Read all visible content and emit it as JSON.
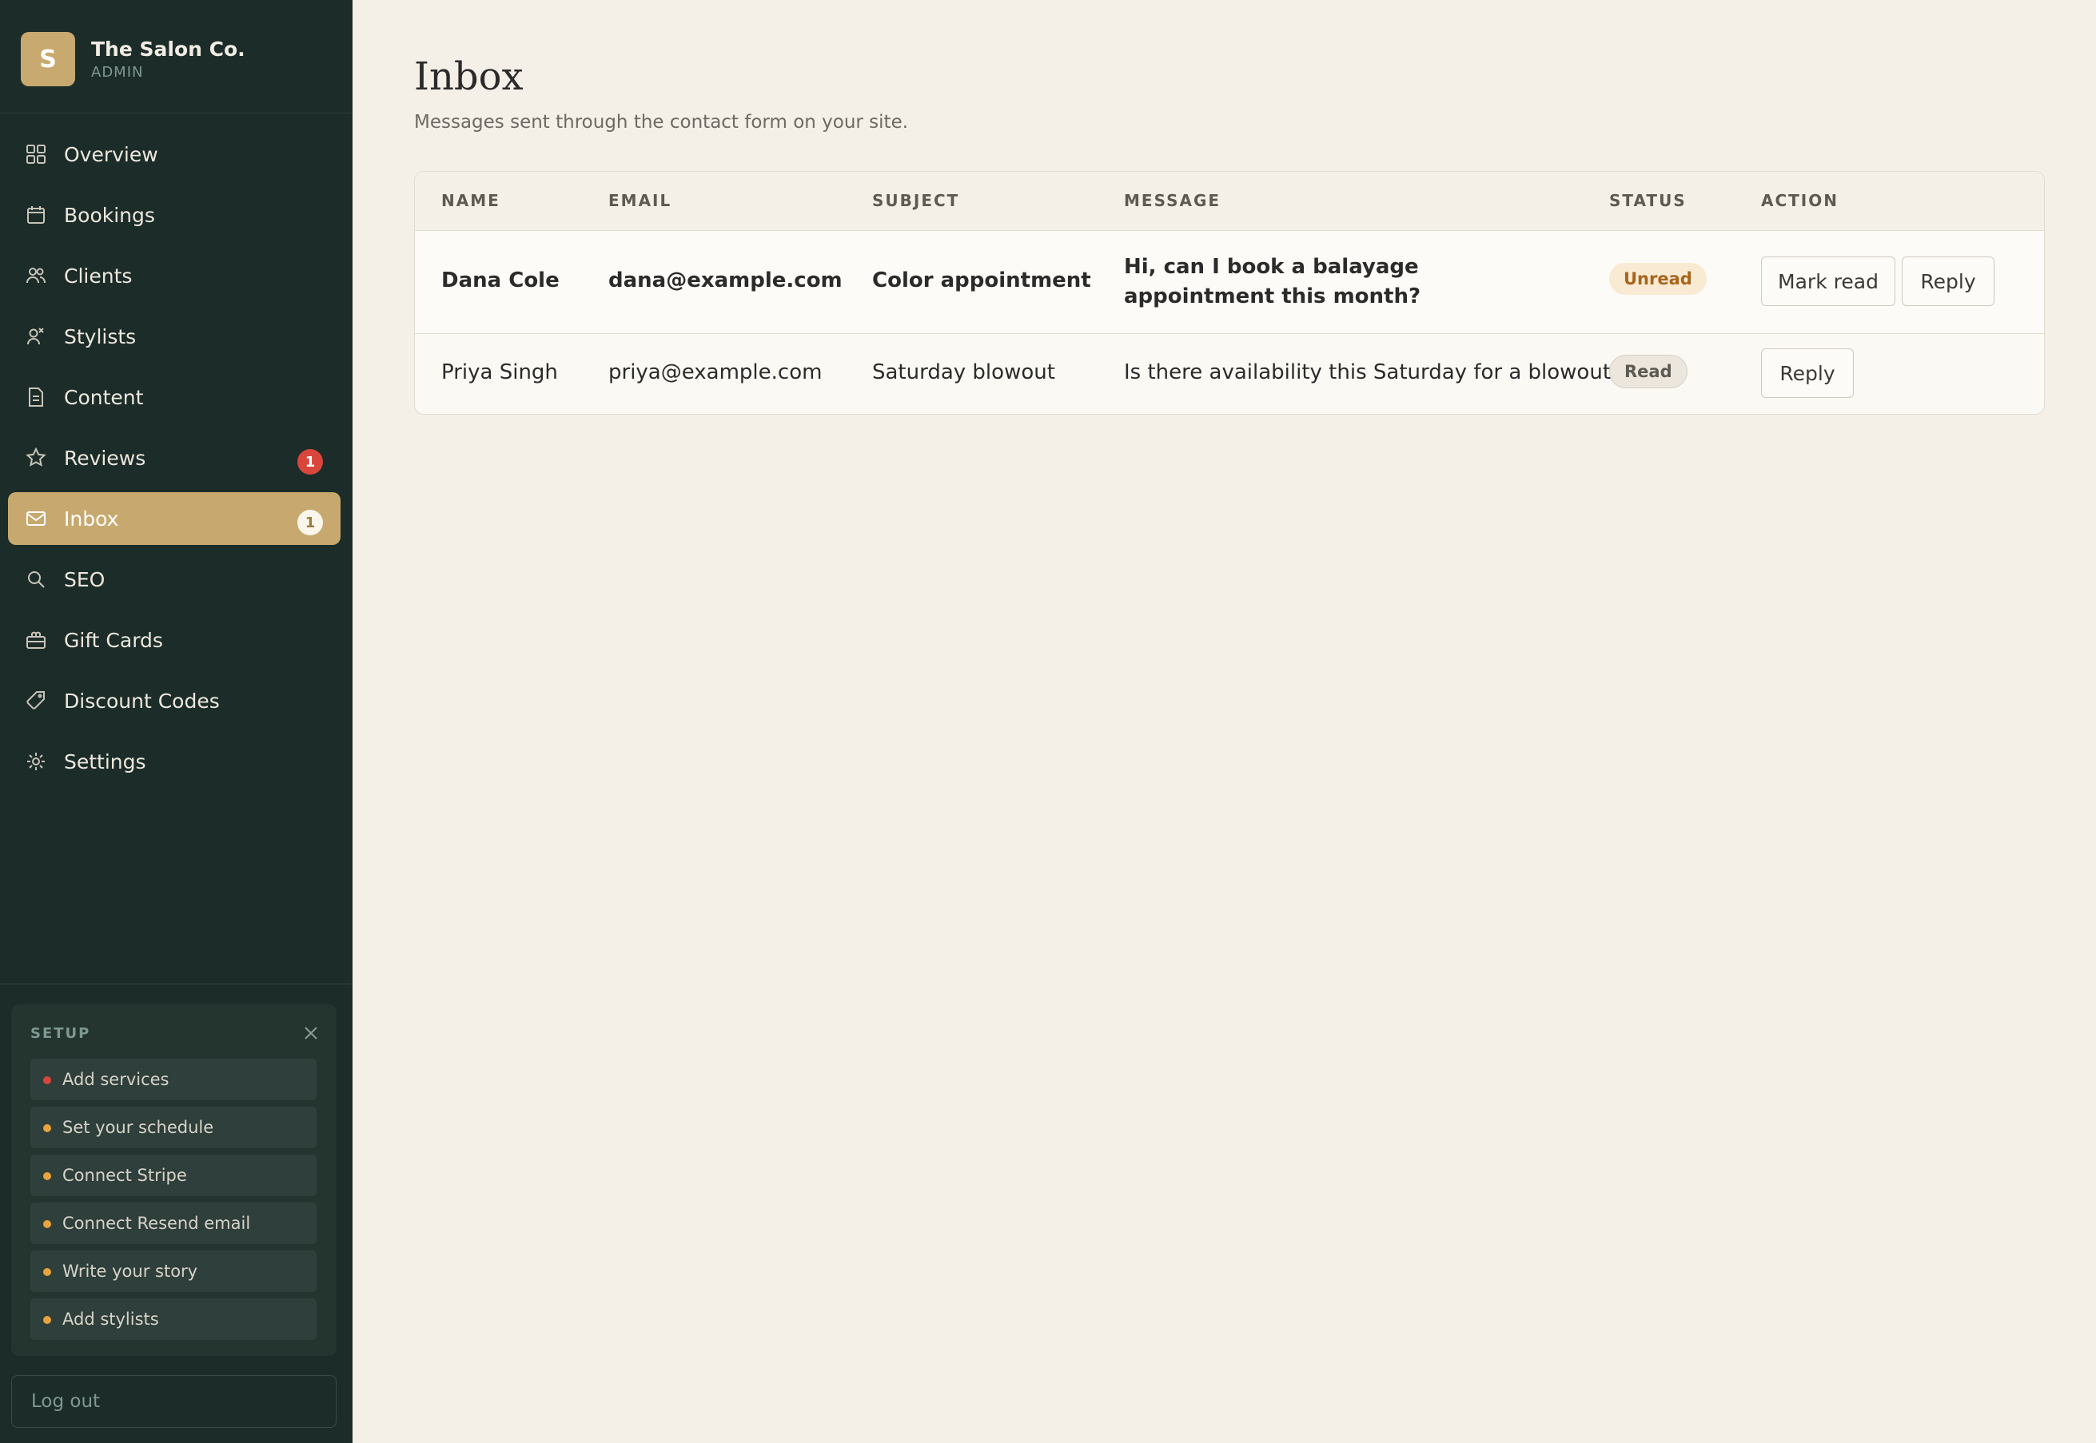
{
  "brand": {
    "initial": "S",
    "name": "The Salon Co.",
    "role": "ADMIN"
  },
  "nav": [
    {
      "label": "Overview",
      "icon": "grid-icon"
    },
    {
      "label": "Bookings",
      "icon": "calendar-icon"
    },
    {
      "label": "Clients",
      "icon": "users-icon"
    },
    {
      "label": "Stylists",
      "icon": "stylist-icon"
    },
    {
      "label": "Content",
      "icon": "document-icon"
    },
    {
      "label": "Reviews",
      "icon": "star-icon",
      "badge": "1"
    },
    {
      "label": "Inbox",
      "icon": "mail-icon",
      "badge": "1",
      "active": true
    },
    {
      "label": "SEO",
      "icon": "search-icon"
    },
    {
      "label": "Gift Cards",
      "icon": "gift-icon"
    },
    {
      "label": "Discount Codes",
      "icon": "tag-icon"
    },
    {
      "label": "Settings",
      "icon": "gear-icon"
    }
  ],
  "setup": {
    "title": "SETUP",
    "items": [
      {
        "label": "Add services",
        "color": "#d9463b"
      },
      {
        "label": "Set your schedule",
        "color": "#e8a33a"
      },
      {
        "label": "Connect Stripe",
        "color": "#e8a33a"
      },
      {
        "label": "Connect Resend email",
        "color": "#e8a33a"
      },
      {
        "label": "Write your story",
        "color": "#e8a33a"
      },
      {
        "label": "Add stylists",
        "color": "#e8a33a"
      }
    ]
  },
  "logout_label": "Log out",
  "page": {
    "title": "Inbox",
    "subtitle": "Messages sent through the contact form on your site."
  },
  "table": {
    "headers": [
      "NAME",
      "EMAIL",
      "SUBJECT",
      "MESSAGE",
      "STATUS",
      "ACTION"
    ],
    "rows": [
      {
        "name": "Dana Cole",
        "email": "dana@example.com",
        "subject": "Color appointment",
        "message": "Hi, can I book a balayage appointment this month?",
        "status": "Unread",
        "actions": [
          "Mark read",
          "Reply"
        ]
      },
      {
        "name": "Priya Singh",
        "email": "priya@example.com",
        "subject": "Saturday blowout",
        "message": "Is there availability this Saturday for a blowout?",
        "status": "Read",
        "actions": [
          "Reply"
        ]
      }
    ]
  },
  "colors": {
    "sidebar": "#1c2c29",
    "accent": "#c7a96f",
    "background": "#f4efe7",
    "badge": "#d9463b",
    "unread": "#a8651d"
  }
}
